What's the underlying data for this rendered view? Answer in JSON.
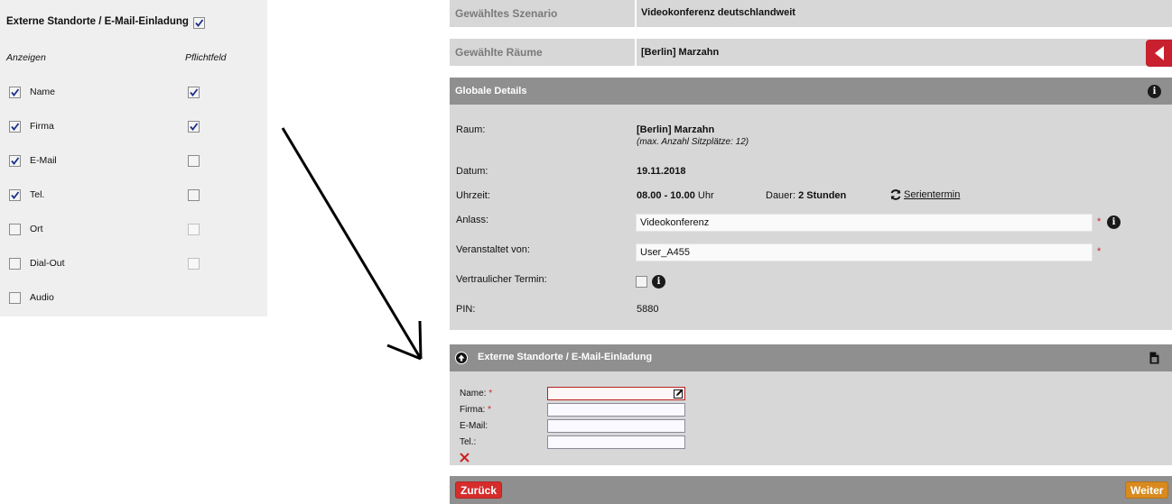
{
  "config": {
    "title": "Externe Standorte / E-Mail-Einladung",
    "title_checked": true,
    "col_show": "Anzeigen",
    "col_required": "Pflichtfeld",
    "rows": [
      {
        "label": "Name",
        "show": true,
        "required": true,
        "required_disabled": false
      },
      {
        "label": "Firma",
        "show": true,
        "required": true,
        "required_disabled": false
      },
      {
        "label": "E-Mail",
        "show": true,
        "required": false,
        "required_disabled": false
      },
      {
        "label": "Tel.",
        "show": true,
        "required": false,
        "required_disabled": false
      },
      {
        "label": "Ort",
        "show": false,
        "required": false,
        "required_disabled": true
      },
      {
        "label": "Dial-Out",
        "show": false,
        "required": false,
        "required_disabled": true
      },
      {
        "label": "Audio",
        "show": false,
        "required": null,
        "required_disabled": true
      }
    ]
  },
  "scenario": {
    "label": "Gewähltes Szenario",
    "value": "Videokonferenz deutschlandweit"
  },
  "rooms": {
    "label": "Gewählte Räume",
    "value": "[Berlin] Marzahn"
  },
  "global": {
    "title": "Globale Details",
    "room_label": "Raum:",
    "room_value": "[Berlin] Marzahn",
    "room_note": "(max. Anzahl Sitzplätze: 12)",
    "date_label": "Datum:",
    "date_value": "19.11.2018",
    "time_label": "Uhrzeit:",
    "time_value": "08.00 - 10.00",
    "time_unit": "Uhr",
    "duration_label": "Dauer:",
    "duration_value": "2 Stunden",
    "series_label": "Serientermin",
    "occasion_label": "Anlass:",
    "occasion_value": "Videokonferenz",
    "organizer_label": "Veranstaltet von:",
    "organizer_value": "User_A455",
    "confidential_label": "Vertraulicher Termin:",
    "pin_label": "PIN:",
    "pin_value": "5880",
    "required_mark": "*"
  },
  "external": {
    "title": "Externe Standorte / E-Mail-Einladung",
    "name_label": "Name:",
    "company_label": "Firma:",
    "email_label": "E-Mail:",
    "phone_label": "Tel.:",
    "required_mark": "*"
  },
  "footer": {
    "back_label": "Zurück",
    "next_label": "Weiter"
  },
  "colors": {
    "back": "#d62c2c",
    "next": "#d98a1e",
    "collapse": "#c8202e"
  }
}
